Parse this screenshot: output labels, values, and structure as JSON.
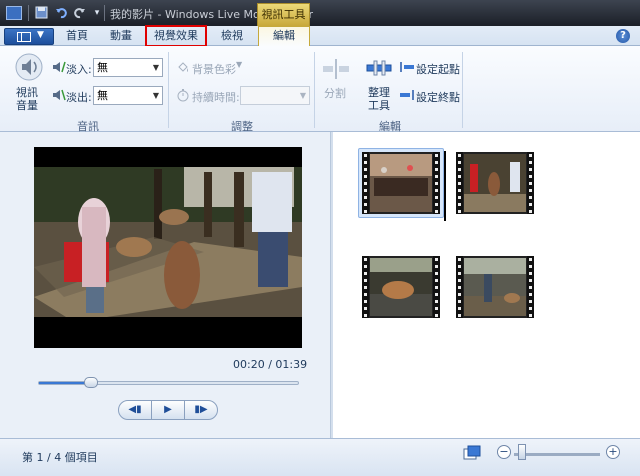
{
  "window": {
    "title": "我的影片 - Windows Live Movie Maker",
    "context_group": "視訊工具"
  },
  "tabs": [
    {
      "label": "首頁"
    },
    {
      "label": "動畫"
    },
    {
      "label": "視覺效果"
    },
    {
      "label": "檢視"
    },
    {
      "label": "編輯"
    }
  ],
  "ribbon": {
    "audio": {
      "video_volume_line1": "視訊",
      "video_volume_line2": "音量",
      "fade_in_label": "淡入:",
      "fade_in_value": "無",
      "fade_out_label": "淡出:",
      "fade_out_value": "無",
      "group_label": "音訊"
    },
    "adjust": {
      "background_color_label": "背景色彩",
      "duration_label": "持續時間:",
      "duration_value": "",
      "group_label": "調整"
    },
    "editing": {
      "split_label": "分割",
      "trim_line1": "整理",
      "trim_line2": "工具",
      "set_start_label": "設定起點",
      "set_end_label": "設定終點",
      "group_label": "編輯"
    }
  },
  "player": {
    "time_display": "00:20 / 01:39",
    "progress": 0.202
  },
  "status": {
    "text": "第 1 / 4 個項目",
    "zoom_fraction": 0.05
  },
  "colors": {
    "highlight_box": "#e00000",
    "context_tab": "#e2c75a",
    "accent": "#3a78d4"
  },
  "icons": [
    "app-menu-icon",
    "save-icon",
    "undo-icon",
    "redo-icon",
    "help-icon",
    "speaker-icon",
    "fade-in-icon",
    "fade-out-icon",
    "paint-bucket-icon",
    "stopwatch-icon",
    "split-icon",
    "trim-icon",
    "set-start-icon",
    "set-end-icon",
    "previous-frame-icon",
    "play-icon",
    "next-frame-icon",
    "storyboard-icon",
    "zoom-out-icon",
    "zoom-in-icon"
  ]
}
